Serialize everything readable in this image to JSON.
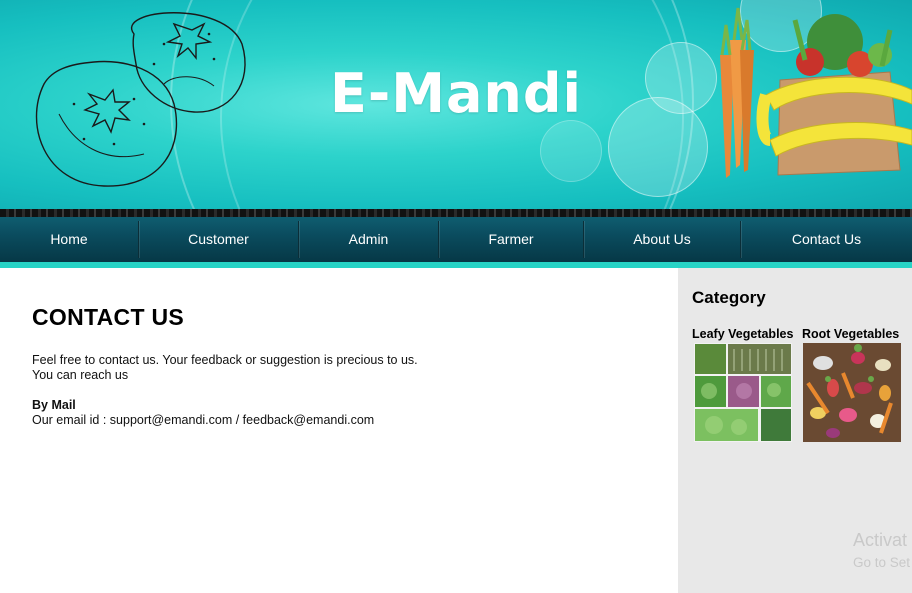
{
  "header": {
    "site_title": "E-Mandi"
  },
  "nav": {
    "items": [
      {
        "label": "Home"
      },
      {
        "label": "Customer"
      },
      {
        "label": "Admin"
      },
      {
        "label": "Farmer"
      },
      {
        "label": "About Us"
      },
      {
        "label": "Contact Us"
      }
    ]
  },
  "main": {
    "heading": "CONTACT US",
    "intro_line1": "Feel free to contact us. Your feedback or suggestion is precious to us.",
    "intro_line2": "You can reach us",
    "mail_heading": "By Mail",
    "email_line": "Our email id : support@emandi.com / feedback@emandi.com"
  },
  "sidebar": {
    "heading": "Category",
    "categories": [
      {
        "label": "Leafy Vegetables"
      },
      {
        "label": "Root Vegetables"
      }
    ]
  },
  "watermark": {
    "line1": "Activat",
    "line2": "Go to Set"
  },
  "colors": {
    "header_teal": "#2dd3cb",
    "nav_dark": "#0a4a5c",
    "nav_accent": "#27d4c6",
    "sidebar_bg": "#e8e8e8"
  }
}
